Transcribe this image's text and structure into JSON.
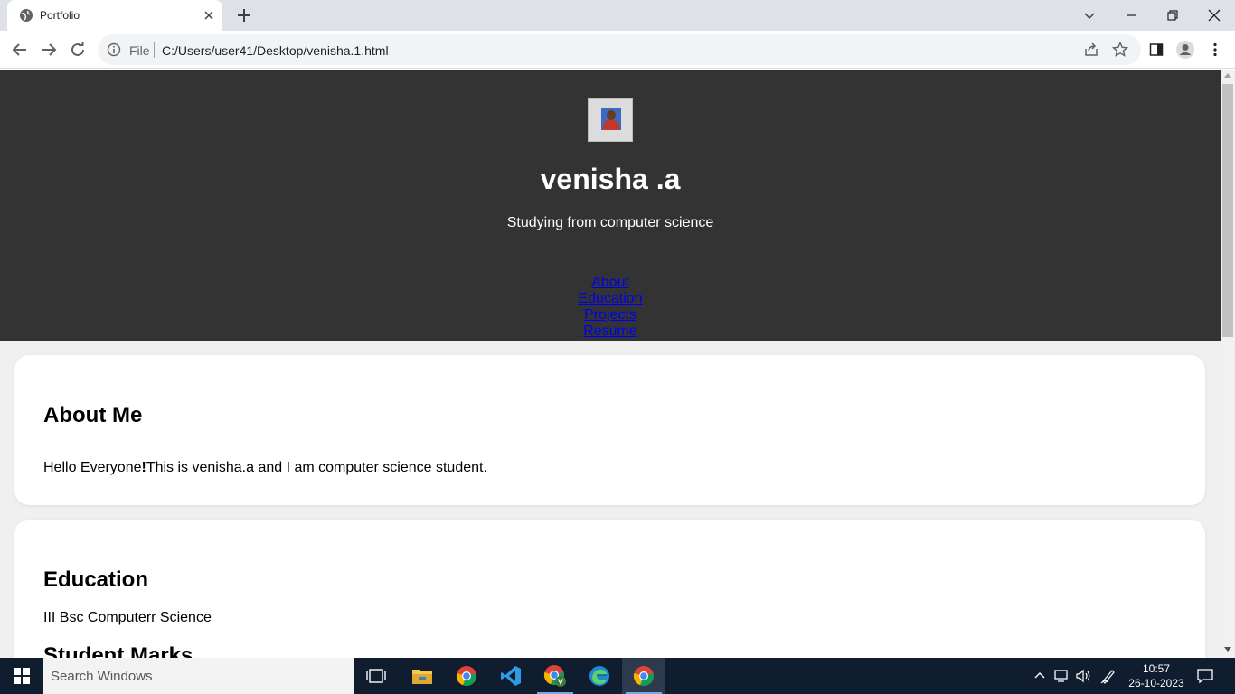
{
  "browser": {
    "tab_title": "Portfolio",
    "address_scheme_label": "File",
    "address_url": "C:/Users/user41/Desktop/venisha.1.html"
  },
  "header": {
    "name": "venisha .a",
    "tagline": "Studying from computer science",
    "nav": [
      "About",
      "Education",
      "Projects",
      "Resume"
    ]
  },
  "about": {
    "heading": "About Me",
    "text_prefix": "Hello Everyone",
    "text_bang": "!",
    "text_suffix": "This is venisha.a and I am computer science student."
  },
  "education": {
    "heading": "Education",
    "degree": "III Bsc Computerr Science",
    "subheading": "Student Marks"
  },
  "taskbar": {
    "search_placeholder": "Search Windows",
    "time": "10:57",
    "date": "26-10-2023"
  }
}
